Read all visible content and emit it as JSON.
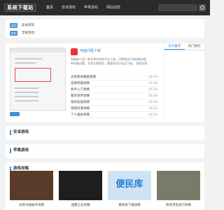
{
  "header": {
    "logo": "系统下载站",
    "nav": [
      "首页",
      "安卓游戏",
      "苹果游戏",
      "网站动态"
    ],
    "search_placeholder": ""
  },
  "categories": [
    {
      "tag": "类别",
      "label": "安卓游戏"
    },
    {
      "tag": "类别",
      "label": "苹果游戏"
    }
  ],
  "featured": {
    "app_title": "电脑问题下载",
    "description": "电脑病人是一款非常优秀的专业工具，可帮助用户轻松解决各种电脑问题，非常方便使用，需要的用户欢迎下载。",
    "description_link": "查看详情",
    "news": [
      {
        "title": "光荣使命截图攻略",
        "date": "10-24"
      },
      {
        "title": "选择英雄攻略",
        "date": "10-24"
      },
      {
        "title": "新手入门攻略",
        "date": "10-24"
      },
      {
        "title": "我的世界攻略",
        "date": "10-24"
      },
      {
        "title": "角色技能攻略",
        "date": "10-24"
      },
      {
        "title": "地图资源攻略",
        "date": "10-24"
      },
      {
        "title": "个人通关攻略",
        "date": "10-24"
      }
    ],
    "btn": "下载"
  },
  "ranking": {
    "tabs": [
      "近日推荐",
      "热门排行"
    ]
  },
  "sections": {
    "android": "安卓游戏",
    "apple": "苹果游戏",
    "guides": "游戏攻略"
  },
  "guides": [
    {
      "caption": "光荣大陆秘术攻略",
      "color": "#5a3a2a"
    },
    {
      "caption": "迷雾之岛攻略",
      "color": "#1e1e1e"
    },
    {
      "caption": "重新排下载攻略",
      "color": "#cfe3f3",
      "watermark": "便民库"
    },
    {
      "caption": "绝地求生技巧攻略",
      "color": "#7a7a6a"
    }
  ]
}
